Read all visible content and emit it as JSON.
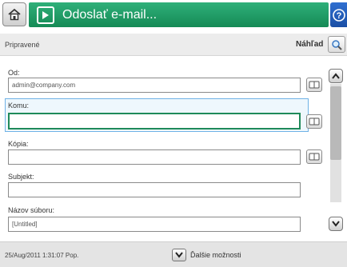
{
  "header": {
    "title": "Odoslať e-mail...",
    "home_icon": "home-icon",
    "title_icon": "send-email-icon",
    "help_icon": "help-icon",
    "accent": "#1a9a63"
  },
  "status": {
    "text": "Pripravené",
    "preview_label": "Náhľad"
  },
  "form": {
    "from": {
      "label": "Od:",
      "value": "admin@company.com"
    },
    "to": {
      "label": "Komu:",
      "value": ""
    },
    "cc": {
      "label": "Kópia:",
      "value": ""
    },
    "subject": {
      "label": "Subjekt:",
      "value": ""
    },
    "filename": {
      "label": "Názov súboru:",
      "value": "[Untitled]"
    }
  },
  "footer": {
    "timestamp": "25/Aug/2011 1:31:07 Pop.",
    "more_options": "Ďalšie možnosti"
  }
}
